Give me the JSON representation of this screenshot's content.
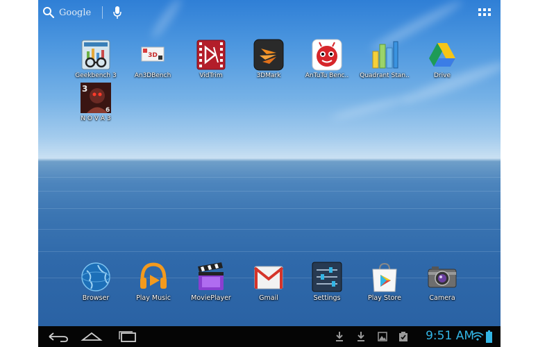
{
  "search": {
    "label": "Google"
  },
  "apps": [
    {
      "label": "Geekbench 3",
      "icon": "geekbench-icon"
    },
    {
      "label": "An3DBench",
      "icon": "an3dbench-icon"
    },
    {
      "label": "VidTrim",
      "icon": "vidtrim-icon"
    },
    {
      "label": "3DMark",
      "icon": "3dmark-icon"
    },
    {
      "label": "AnTuTu Benc..",
      "icon": "antutu-icon"
    },
    {
      "label": "Quadrant Stan..",
      "icon": "quadrant-icon"
    },
    {
      "label": "Drive",
      "icon": "drive-icon"
    },
    {
      "label": "N O V A 3",
      "icon": "nova3-icon"
    }
  ],
  "dock": [
    {
      "label": "Browser",
      "icon": "browser-icon"
    },
    {
      "label": "Play Music",
      "icon": "play-music-icon"
    },
    {
      "label": "MoviePlayer",
      "icon": "movieplayer-icon"
    },
    {
      "label": "Gmail",
      "icon": "gmail-icon"
    },
    {
      "label": "Settings",
      "icon": "settings-icon"
    },
    {
      "label": "Play Store",
      "icon": "play-store-icon"
    },
    {
      "label": "Camera",
      "icon": "camera-icon"
    }
  ],
  "status": {
    "time": "9:51 AM"
  },
  "colors": {
    "accent": "#33b5e5",
    "navbar": "#050505"
  }
}
